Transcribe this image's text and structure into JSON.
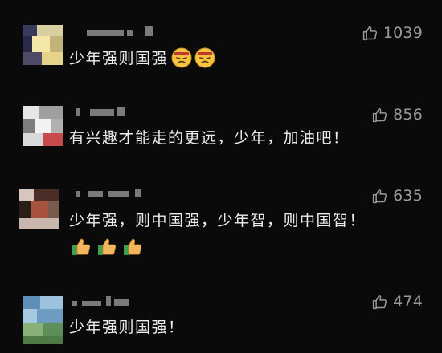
{
  "comments": [
    {
      "likes": "1039",
      "text": "少年强则国强",
      "emojis": [
        "cursing-face-emoji",
        "cursing-face-emoji"
      ]
    },
    {
      "likes": "856",
      "text": "有兴趣才能走的更远，少年，加油吧！",
      "emojis": []
    },
    {
      "likes": "635",
      "text": "少年强，则中国强，少年智，则中国智！",
      "emojis": [
        "thumbs-up-emoji",
        "thumbs-up-emoji",
        "thumbs-up-emoji"
      ]
    },
    {
      "likes": "474",
      "text": "少年强则国强！",
      "emojis": []
    }
  ],
  "icons": {
    "like": "thumbs-up-outline-icon"
  },
  "colors": {
    "background": "#0a0a0a",
    "text": "#ededed",
    "meta": "#9a9a9a"
  }
}
